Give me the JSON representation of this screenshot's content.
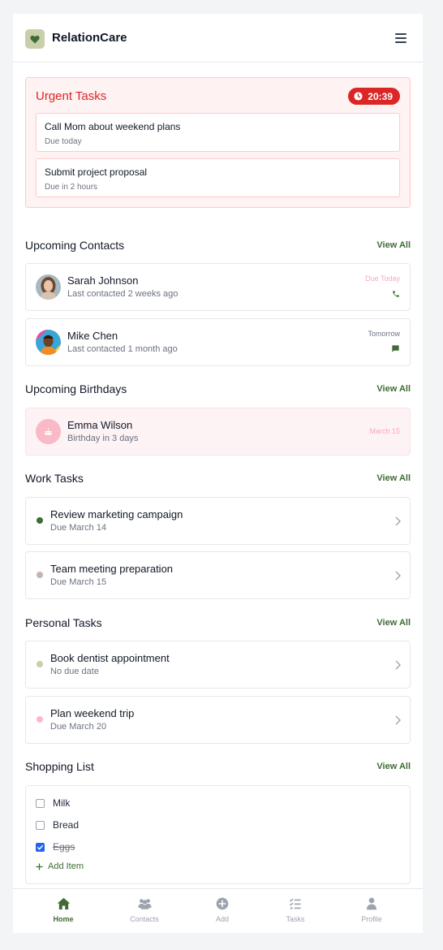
{
  "app": {
    "title": "RelationCare"
  },
  "urgent": {
    "title": "Urgent Tasks",
    "timer": "20:39",
    "tasks": [
      {
        "title": "Call Mom about weekend plans",
        "due": "Due today"
      },
      {
        "title": "Submit project proposal",
        "due": "Due in 2 hours"
      }
    ]
  },
  "contacts": {
    "title": "Upcoming Contacts",
    "view_all": "View All",
    "items": [
      {
        "name": "Sarah Johnson",
        "sub": "Last contacted 2 weeks ago",
        "when": "Due Today",
        "when_color": "#f9a8b8",
        "icon": "phone-icon"
      },
      {
        "name": "Mike Chen",
        "sub": "Last contacted 1 month ago",
        "when": "Tomorrow",
        "when_color": "#6b7280",
        "icon": "message-icon"
      }
    ]
  },
  "birthdays": {
    "title": "Upcoming Birthdays",
    "view_all": "View All",
    "items": [
      {
        "name": "Emma Wilson",
        "sub": "Birthday in 3 days",
        "date": "March 15"
      }
    ]
  },
  "work": {
    "title": "Work Tasks",
    "view_all": "View All",
    "items": [
      {
        "name": "Review marketing campaign",
        "sub": "Due March 14",
        "dot": "#3f6b35"
      },
      {
        "name": "Team meeting preparation",
        "sub": "Due March 15",
        "dot": "#c4b5ae"
      }
    ]
  },
  "personal": {
    "title": "Personal Tasks",
    "view_all": "View All",
    "items": [
      {
        "name": "Book dentist appointment",
        "sub": "No due date",
        "dot": "#c9ceab"
      },
      {
        "name": "Plan weekend trip",
        "sub": "Due March 20",
        "dot": "#f9b9c7"
      }
    ]
  },
  "shopping": {
    "title": "Shopping List",
    "view_all": "View All",
    "items": [
      {
        "label": "Milk",
        "checked": false
      },
      {
        "label": "Bread",
        "checked": false
      },
      {
        "label": "Eggs",
        "checked": true
      }
    ],
    "add_label": "Add Item"
  },
  "nav": {
    "items": [
      {
        "label": "Home",
        "icon": "home-icon",
        "active": true
      },
      {
        "label": "Contacts",
        "icon": "contacts-icon",
        "active": false
      },
      {
        "label": "Add",
        "icon": "add-icon",
        "active": false
      },
      {
        "label": "Tasks",
        "icon": "tasks-icon",
        "active": false
      },
      {
        "label": "Profile",
        "icon": "profile-icon",
        "active": false
      }
    ]
  },
  "colors": {
    "accent": "#3f6b35",
    "urgent": "#dc2626",
    "brand_bg": "#c9ceab"
  }
}
